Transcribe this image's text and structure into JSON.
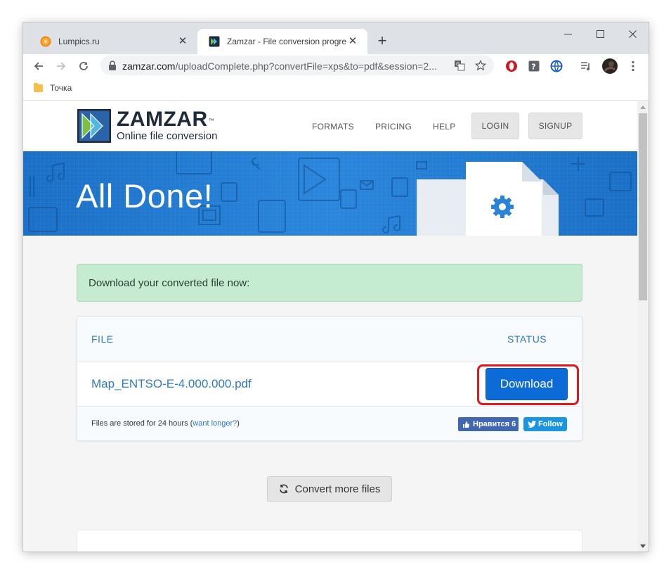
{
  "browser": {
    "tabs": [
      {
        "title": "Lumpics.ru",
        "active": false,
        "favicon": "orange-circle-icon"
      },
      {
        "title": "Zamzar - File conversion progre",
        "active": true,
        "favicon": "zamzar-icon"
      }
    ],
    "close_glyph": "✕",
    "new_tab_glyph": "+",
    "url": {
      "host": "zamzar.com",
      "path": "/uploadComplete.php?convertFile=xps&to=pdf&session=2..."
    },
    "bookmark": "Точка"
  },
  "site": {
    "logo_name": "ZAMZAR",
    "logo_tm": "™",
    "logo_tagline": "Online file conversion",
    "nav": [
      "FORMATS",
      "PRICING",
      "HELP"
    ],
    "login_label": "LOGIN",
    "signup_label": "SIGNUP"
  },
  "banner": {
    "title": "All Done!"
  },
  "alert": {
    "text": "Download your converted file now:"
  },
  "file_table": {
    "col_file": "FILE",
    "col_status": "STATUS",
    "file_name": "Map_ENTSO-E-4.000.000.pdf",
    "download_label": "Download",
    "note_prefix": "Files are stored for 24 hours (",
    "note_link": "want longer?",
    "note_suffix": ")",
    "fb_label": "Нравится 6",
    "tw_label": "Follow"
  },
  "convert_more_label": "Convert more files",
  "colors": {
    "brand_blue": "#0d6bd7",
    "banner_blue": "#1d7ad0",
    "highlight_red": "#e2161c",
    "alert_green": "#c5ecd0"
  }
}
